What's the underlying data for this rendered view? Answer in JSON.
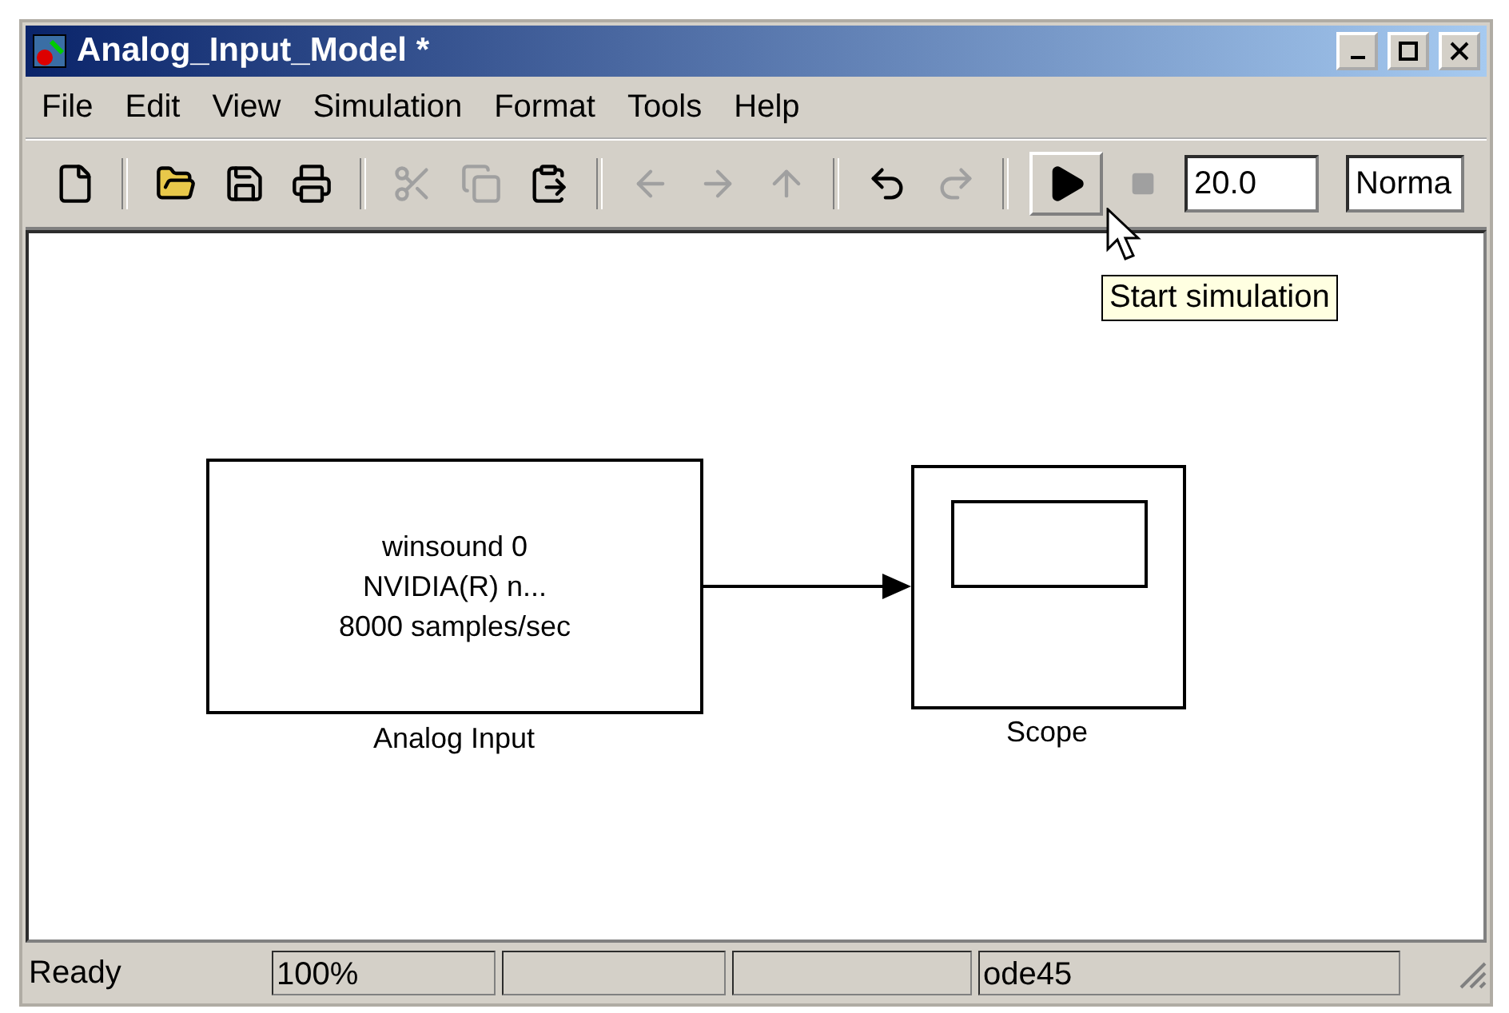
{
  "window": {
    "title": "Analog_Input_Model *"
  },
  "menu": [
    "File",
    "Edit",
    "View",
    "Simulation",
    "Format",
    "Tools",
    "Help"
  ],
  "toolbar": {
    "groups": [
      [
        {
          "disabled": false
        }
      ],
      [
        {
          "disabled": false
        },
        {
          "disabled": false
        },
        {
          "disabled": false
        }
      ],
      [
        {
          "disabled": true
        },
        {
          "disabled": true
        },
        {
          "disabled": false
        }
      ],
      [
        {
          "disabled": true
        },
        {
          "disabled": true
        },
        {
          "disabled": true
        }
      ],
      [
        {
          "disabled": false
        },
        {
          "disabled": true
        }
      ],
      [
        {
          "disabled": false,
          "pressed": true
        },
        {
          "disabled": true,
          "pressed": false
        }
      ]
    ],
    "stop_time": "20.0",
    "mode": "Norma"
  },
  "tooltip": "Start simulation",
  "blocks": [
    {
      "kind": "source",
      "lines": [
        "winsound 0",
        "NVIDIA(R) n...",
        "8000 samples/sec"
      ],
      "label": "Analog Input"
    },
    {
      "kind": "scope",
      "label": "Scope"
    }
  ],
  "status_bar": {
    "message": "Ready",
    "zoom": "100%",
    "solver": "ode45"
  }
}
